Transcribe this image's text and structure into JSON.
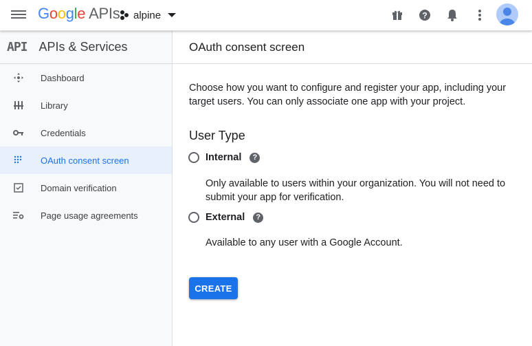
{
  "header": {
    "logo_google": [
      "G",
      "o",
      "o",
      "g",
      "l",
      "e"
    ],
    "logo_apis": "APIs",
    "project_name": "alpine",
    "icons": [
      "menu-icon",
      "gift-icon",
      "help-icon",
      "notifications-icon",
      "more-vert-icon",
      "avatar"
    ]
  },
  "sidebar": {
    "api_mark": "API",
    "title": "APIs & Services",
    "items": [
      {
        "label": "Dashboard",
        "icon": "dashboard-icon",
        "active": false
      },
      {
        "label": "Library",
        "icon": "library-icon",
        "active": false
      },
      {
        "label": "Credentials",
        "icon": "key-icon",
        "active": false
      },
      {
        "label": "OAuth consent screen",
        "icon": "consent-icon",
        "active": true
      },
      {
        "label": "Domain verification",
        "icon": "checkbox-icon",
        "active": false
      },
      {
        "label": "Page usage agreements",
        "icon": "settings-list-icon",
        "active": false
      }
    ]
  },
  "main": {
    "title": "OAuth consent screen",
    "description": "Choose how you want to configure and register your app, including your target users. You can only associate one app with your project.",
    "user_type_heading": "User Type",
    "options": [
      {
        "label": "Internal",
        "description": "Only available to users within your organization. You will not need to submit your app for verification.",
        "selected": false
      },
      {
        "label": "External",
        "description": "Available to any user with a Google Account.",
        "selected": false
      }
    ],
    "help_glyph": "?",
    "create_label": "CREATE"
  },
  "colors": {
    "accent": "#1a73e8",
    "active_bg": "#e8f0fe",
    "sidebar_bg": "#f8f9fa",
    "icon_gray": "#5f6368"
  }
}
